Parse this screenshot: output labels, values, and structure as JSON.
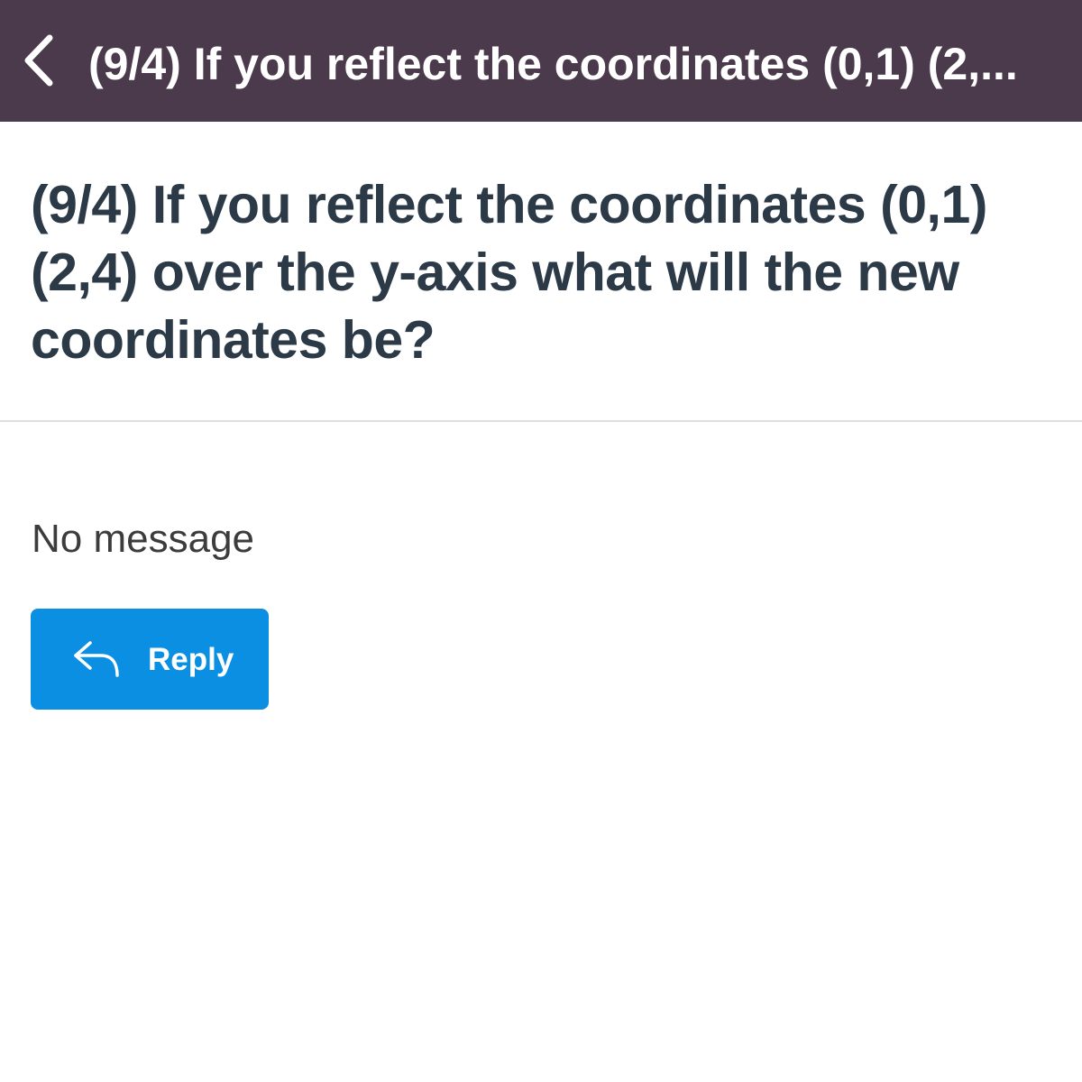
{
  "header": {
    "back_icon": "chevron-left-icon",
    "title": "(9/4) If you reflect the coordinates (0,1) (2,...",
    "background_color": "#4b3a4b"
  },
  "post": {
    "question": "(9/4) If you reflect the coordinates (0,1) (2,4) over the y-axis what will the new coordinates be?",
    "message": "No message"
  },
  "actions": {
    "reply_icon": "reply-arrow-icon",
    "reply_label": "Reply",
    "reply_color": "#0a8fe3"
  }
}
